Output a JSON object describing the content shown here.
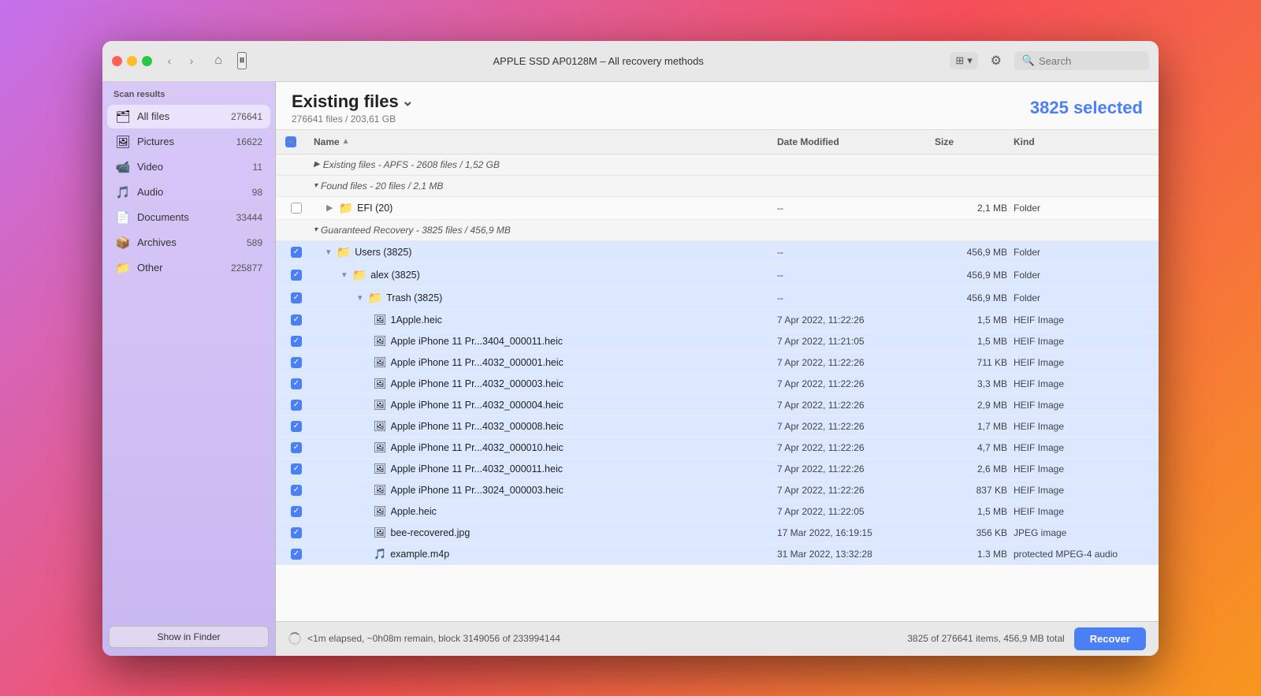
{
  "window": {
    "title": "APPLE SSD AP0128M – All recovery methods"
  },
  "sidebar": {
    "section_title": "Scan results",
    "items": [
      {
        "id": "all-files",
        "label": "All files",
        "count": "276641",
        "icon": "🗂",
        "active": true
      },
      {
        "id": "pictures",
        "label": "Pictures",
        "count": "16622",
        "icon": "🖼",
        "active": false
      },
      {
        "id": "video",
        "label": "Video",
        "count": "11",
        "icon": "📹",
        "active": false
      },
      {
        "id": "audio",
        "label": "Audio",
        "count": "98",
        "icon": "🎵",
        "active": false
      },
      {
        "id": "documents",
        "label": "Documents",
        "count": "33444",
        "icon": "📄",
        "active": false
      },
      {
        "id": "archives",
        "label": "Archives",
        "count": "589",
        "icon": "📦",
        "active": false
      },
      {
        "id": "other",
        "label": "Other",
        "count": "225877",
        "icon": "📁",
        "active": false
      }
    ],
    "show_finder_label": "Show in Finder"
  },
  "header": {
    "title": "Existing files",
    "subtitle": "276641 files / 203,61 GB",
    "selected_count": "3825 selected"
  },
  "toolbar": {
    "search_placeholder": "Search",
    "pause_title": "Pause"
  },
  "table": {
    "columns": [
      {
        "id": "checkbox",
        "label": ""
      },
      {
        "id": "name",
        "label": "Name"
      },
      {
        "id": "date",
        "label": "Date Modified"
      },
      {
        "id": "size",
        "label": "Size"
      },
      {
        "id": "kind",
        "label": "Kind"
      }
    ],
    "groups": [
      {
        "id": "existing-apfs",
        "label": "Existing files - APFS -",
        "info": "2608 files / 1,52 GB",
        "collapsed": true,
        "indent": 0
      },
      {
        "id": "found-files",
        "label": "Found files -",
        "info": "20 files / 2,1 MB",
        "collapsed": false,
        "indent": 0,
        "children": [
          {
            "id": "efi",
            "name": "EFI (20)",
            "date": "--",
            "size": "2,1 MB",
            "kind": "Folder",
            "indent": 1,
            "checked": false,
            "isFolder": true
          }
        ]
      },
      {
        "id": "guaranteed-recovery",
        "label": "Guaranteed Recovery -",
        "info": "3825 files / 456,9 MB",
        "collapsed": false,
        "indent": 0
      }
    ],
    "rows": [
      {
        "id": "users",
        "name": "Users (3825)",
        "date": "--",
        "size": "456,9 MB",
        "kind": "Folder",
        "indent": 1,
        "checked": true,
        "isFolder": true,
        "expanded": true
      },
      {
        "id": "alex",
        "name": "alex (3825)",
        "date": "--",
        "size": "456,9 MB",
        "kind": "Folder",
        "indent": 2,
        "checked": true,
        "isFolder": true,
        "expanded": true
      },
      {
        "id": "trash",
        "name": "Trash (3825)",
        "date": "--",
        "size": "456,9 MB",
        "kind": "Folder",
        "indent": 3,
        "checked": true,
        "isFolder": true,
        "expanded": true
      },
      {
        "id": "1apple",
        "name": "1Apple.heic",
        "date": "7 Apr 2022, 11:22:26",
        "size": "1,5 MB",
        "kind": "HEIF Image",
        "indent": 4,
        "checked": true,
        "isFolder": false
      },
      {
        "id": "file2",
        "name": "Apple iPhone 11 Pr...3404_000011.heic",
        "date": "7 Apr 2022, 11:21:05",
        "size": "1,5 MB",
        "kind": "HEIF Image",
        "indent": 4,
        "checked": true,
        "isFolder": false
      },
      {
        "id": "file3",
        "name": "Apple iPhone 11 Pr...4032_000001.heic",
        "date": "7 Apr 2022, 11:22:26",
        "size": "711 KB",
        "kind": "HEIF Image",
        "indent": 4,
        "checked": true,
        "isFolder": false
      },
      {
        "id": "file4",
        "name": "Apple iPhone 11 Pr...4032_000003.heic",
        "date": "7 Apr 2022, 11:22:26",
        "size": "3,3 MB",
        "kind": "HEIF Image",
        "indent": 4,
        "checked": true,
        "isFolder": false
      },
      {
        "id": "file5",
        "name": "Apple iPhone 11 Pr...4032_000004.heic",
        "date": "7 Apr 2022, 11:22:26",
        "size": "2,9 MB",
        "kind": "HEIF Image",
        "indent": 4,
        "checked": true,
        "isFolder": false
      },
      {
        "id": "file6",
        "name": "Apple iPhone 11 Pr...4032_000008.heic",
        "date": "7 Apr 2022, 11:22:26",
        "size": "1,7 MB",
        "kind": "HEIF Image",
        "indent": 4,
        "checked": true,
        "isFolder": false
      },
      {
        "id": "file7",
        "name": "Apple iPhone 11 Pr...4032_000010.heic",
        "date": "7 Apr 2022, 11:22:26",
        "size": "4,7 MB",
        "kind": "HEIF Image",
        "indent": 4,
        "checked": true,
        "isFolder": false
      },
      {
        "id": "file8",
        "name": "Apple iPhone 11 Pr...4032_000011.heic",
        "date": "7 Apr 2022, 11:22:26",
        "size": "2,6 MB",
        "kind": "HEIF Image",
        "indent": 4,
        "checked": true,
        "isFolder": false
      },
      {
        "id": "file9",
        "name": "Apple iPhone 11 Pr...3024_000003.heic",
        "date": "7 Apr 2022, 11:22:26",
        "size": "837 KB",
        "kind": "HEIF Image",
        "indent": 4,
        "checked": true,
        "isFolder": false
      },
      {
        "id": "file10",
        "name": "Apple.heic",
        "date": "7 Apr 2022, 11:22:05",
        "size": "1,5 MB",
        "kind": "HEIF Image",
        "indent": 4,
        "checked": true,
        "isFolder": false
      },
      {
        "id": "file11",
        "name": "bee-recovered.jpg",
        "date": "17 Mar 2022, 16:19:15",
        "size": "356 KB",
        "kind": "JPEG image",
        "indent": 4,
        "checked": true,
        "isFolder": false
      },
      {
        "id": "file12",
        "name": "example.m4p",
        "date": "31 Mar 2022, 13:32:28",
        "size": "1.3 MB",
        "kind": "protected MPEG-4 audio",
        "indent": 4,
        "checked": true,
        "isFolder": false
      }
    ]
  },
  "statusbar": {
    "left_text": "<1m elapsed, ~0h08m remain, block 3149056 of 233994144",
    "right_text": "3825 of 276641 items, 456,9 MB total",
    "recover_label": "Recover"
  }
}
